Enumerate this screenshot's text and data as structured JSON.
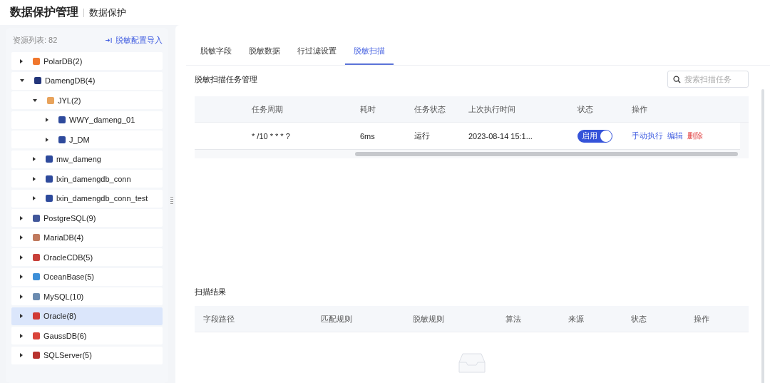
{
  "header": {
    "title": "数据保护管理",
    "subtitle": "数据保护"
  },
  "sidebar": {
    "count_label": "资源列表: 82",
    "import_link": "脱敏配置导入",
    "tree": [
      {
        "label": "PolarDB(2)",
        "color": "#f0772d",
        "expanded": false,
        "selected": false
      },
      {
        "label": "DamengDB(4)",
        "color": "#23357a",
        "expanded": true,
        "selected": false,
        "children": [
          {
            "label": "JYL(2)",
            "color": "#e8a35c",
            "expanded": true,
            "selected": false,
            "children": [
              {
                "label": "WWY_dameng_01",
                "color": "#2e4a9c",
                "expanded": false,
                "selected": false
              },
              {
                "label": "J_DM",
                "color": "#2e4a9c",
                "expanded": false,
                "selected": false
              }
            ]
          },
          {
            "label": "mw_dameng",
            "color": "#2e4a9c",
            "expanded": false,
            "selected": false
          },
          {
            "label": "lxin_damengdb_conn",
            "color": "#2e4a9c",
            "expanded": false,
            "selected": false
          },
          {
            "label": "lxin_damengdb_conn_test",
            "color": "#2e4a9c",
            "expanded": false,
            "selected": false
          }
        ]
      },
      {
        "label": "PostgreSQL(9)",
        "color": "#41579a",
        "expanded": false,
        "selected": false
      },
      {
        "label": "MariaDB(4)",
        "color": "#c07a5e",
        "expanded": false,
        "selected": false
      },
      {
        "label": "OracleCDB(5)",
        "color": "#c8403a",
        "expanded": false,
        "selected": false
      },
      {
        "label": "OceanBase(5)",
        "color": "#3d8fd8",
        "expanded": false,
        "selected": false
      },
      {
        "label": "MySQL(10)",
        "color": "#6b8bb0",
        "expanded": false,
        "selected": false
      },
      {
        "label": "Oracle(8)",
        "color": "#d03a35",
        "expanded": false,
        "selected": true
      },
      {
        "label": "GaussDB(6)",
        "color": "#d9443b",
        "expanded": false,
        "selected": false
      },
      {
        "label": "SQLServer(5)",
        "color": "#b8332e",
        "expanded": false,
        "selected": false
      }
    ]
  },
  "tabs": [
    {
      "label": "脱敏字段",
      "selected": false
    },
    {
      "label": "脱敏数据",
      "selected": false
    },
    {
      "label": "行过滤设置",
      "selected": false
    },
    {
      "label": "脱敏扫描",
      "selected": true
    }
  ],
  "task_section": {
    "title": "脱敏扫描任务管理",
    "search": {
      "placeholder": "搜索扫描任务"
    },
    "columns": [
      "",
      "任务周期",
      "耗时",
      "任务状态",
      "上次执行时间",
      "状态",
      "操作"
    ],
    "rows": [
      {
        "cells": [
          "",
          "* /10 * * * ?",
          "6ms",
          "运行",
          "2023-08-14 15:1..."
        ],
        "toggle": {
          "label": "启用",
          "on": true
        },
        "actions": [
          {
            "label": "手动执行",
            "kind": "link"
          },
          {
            "label": "编辑",
            "kind": "link"
          },
          {
            "label": "删除",
            "kind": "danger"
          }
        ]
      }
    ]
  },
  "result_section": {
    "title": "扫描结果",
    "columns": [
      "字段路径",
      "匹配规则",
      "脱敏规则",
      "算法",
      "来源",
      "状态",
      "操作"
    ]
  }
}
